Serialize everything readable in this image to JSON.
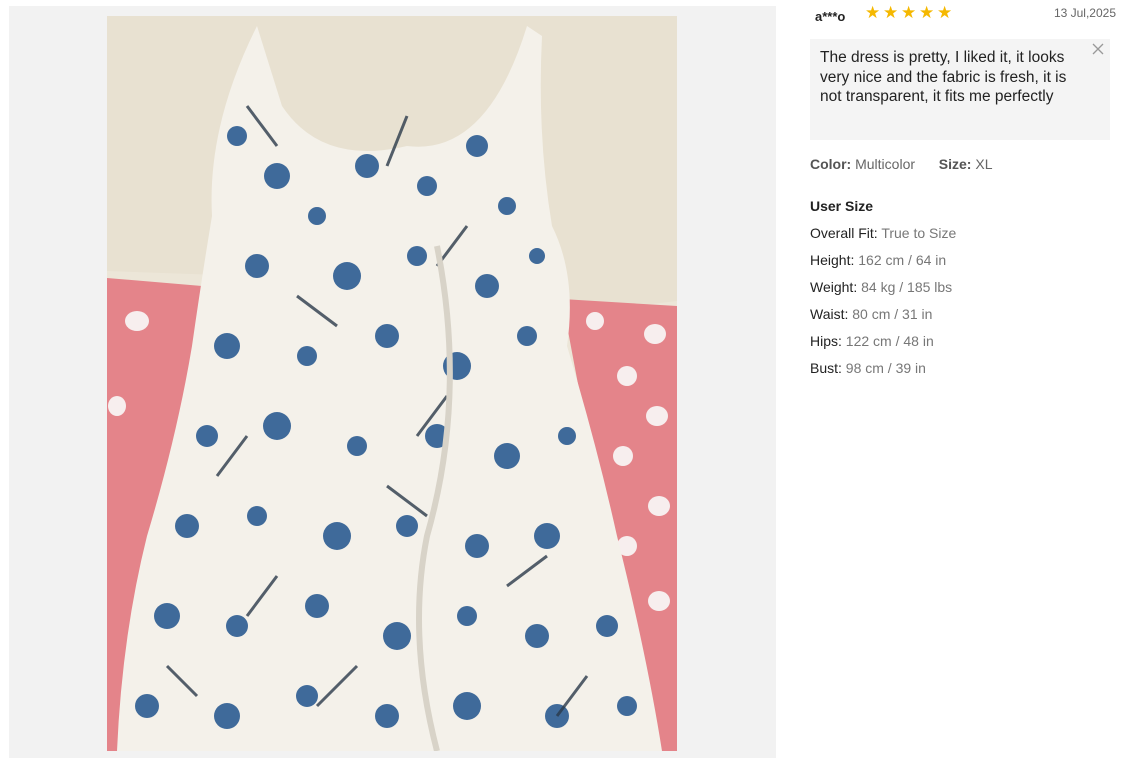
{
  "review": {
    "reviewer": "a***o",
    "rating": 5,
    "date": "13 Jul,2025",
    "comment": "The dress is pretty, I liked it, it looks very nice and the fabric is fresh, it is not transparent, it fits me perfectly",
    "close_icon": "close-icon",
    "star_icon": "star-icon"
  },
  "attributes": {
    "color_label": "Color:",
    "color_value": "Multicolor",
    "size_label": "Size:",
    "size_value": "XL"
  },
  "user_size": {
    "title": "User Size",
    "rows": [
      {
        "label": "Overall Fit:",
        "value": "True to Size"
      },
      {
        "label": "Height:",
        "value": "162 cm / 64 in"
      },
      {
        "label": "Weight:",
        "value": "84 kg / 185 lbs"
      },
      {
        "label": "Waist:",
        "value": "80 cm / 31 in"
      },
      {
        "label": "Hips:",
        "value": "122 cm / 48 in"
      },
      {
        "label": "Bust:",
        "value": "98 cm / 39 in"
      }
    ]
  },
  "colors": {
    "star": "#f5b800",
    "comment_bg": "#f4f4f4",
    "dress_blue": "#3f6a9a",
    "bedsheet_pink": "#e4848a"
  }
}
